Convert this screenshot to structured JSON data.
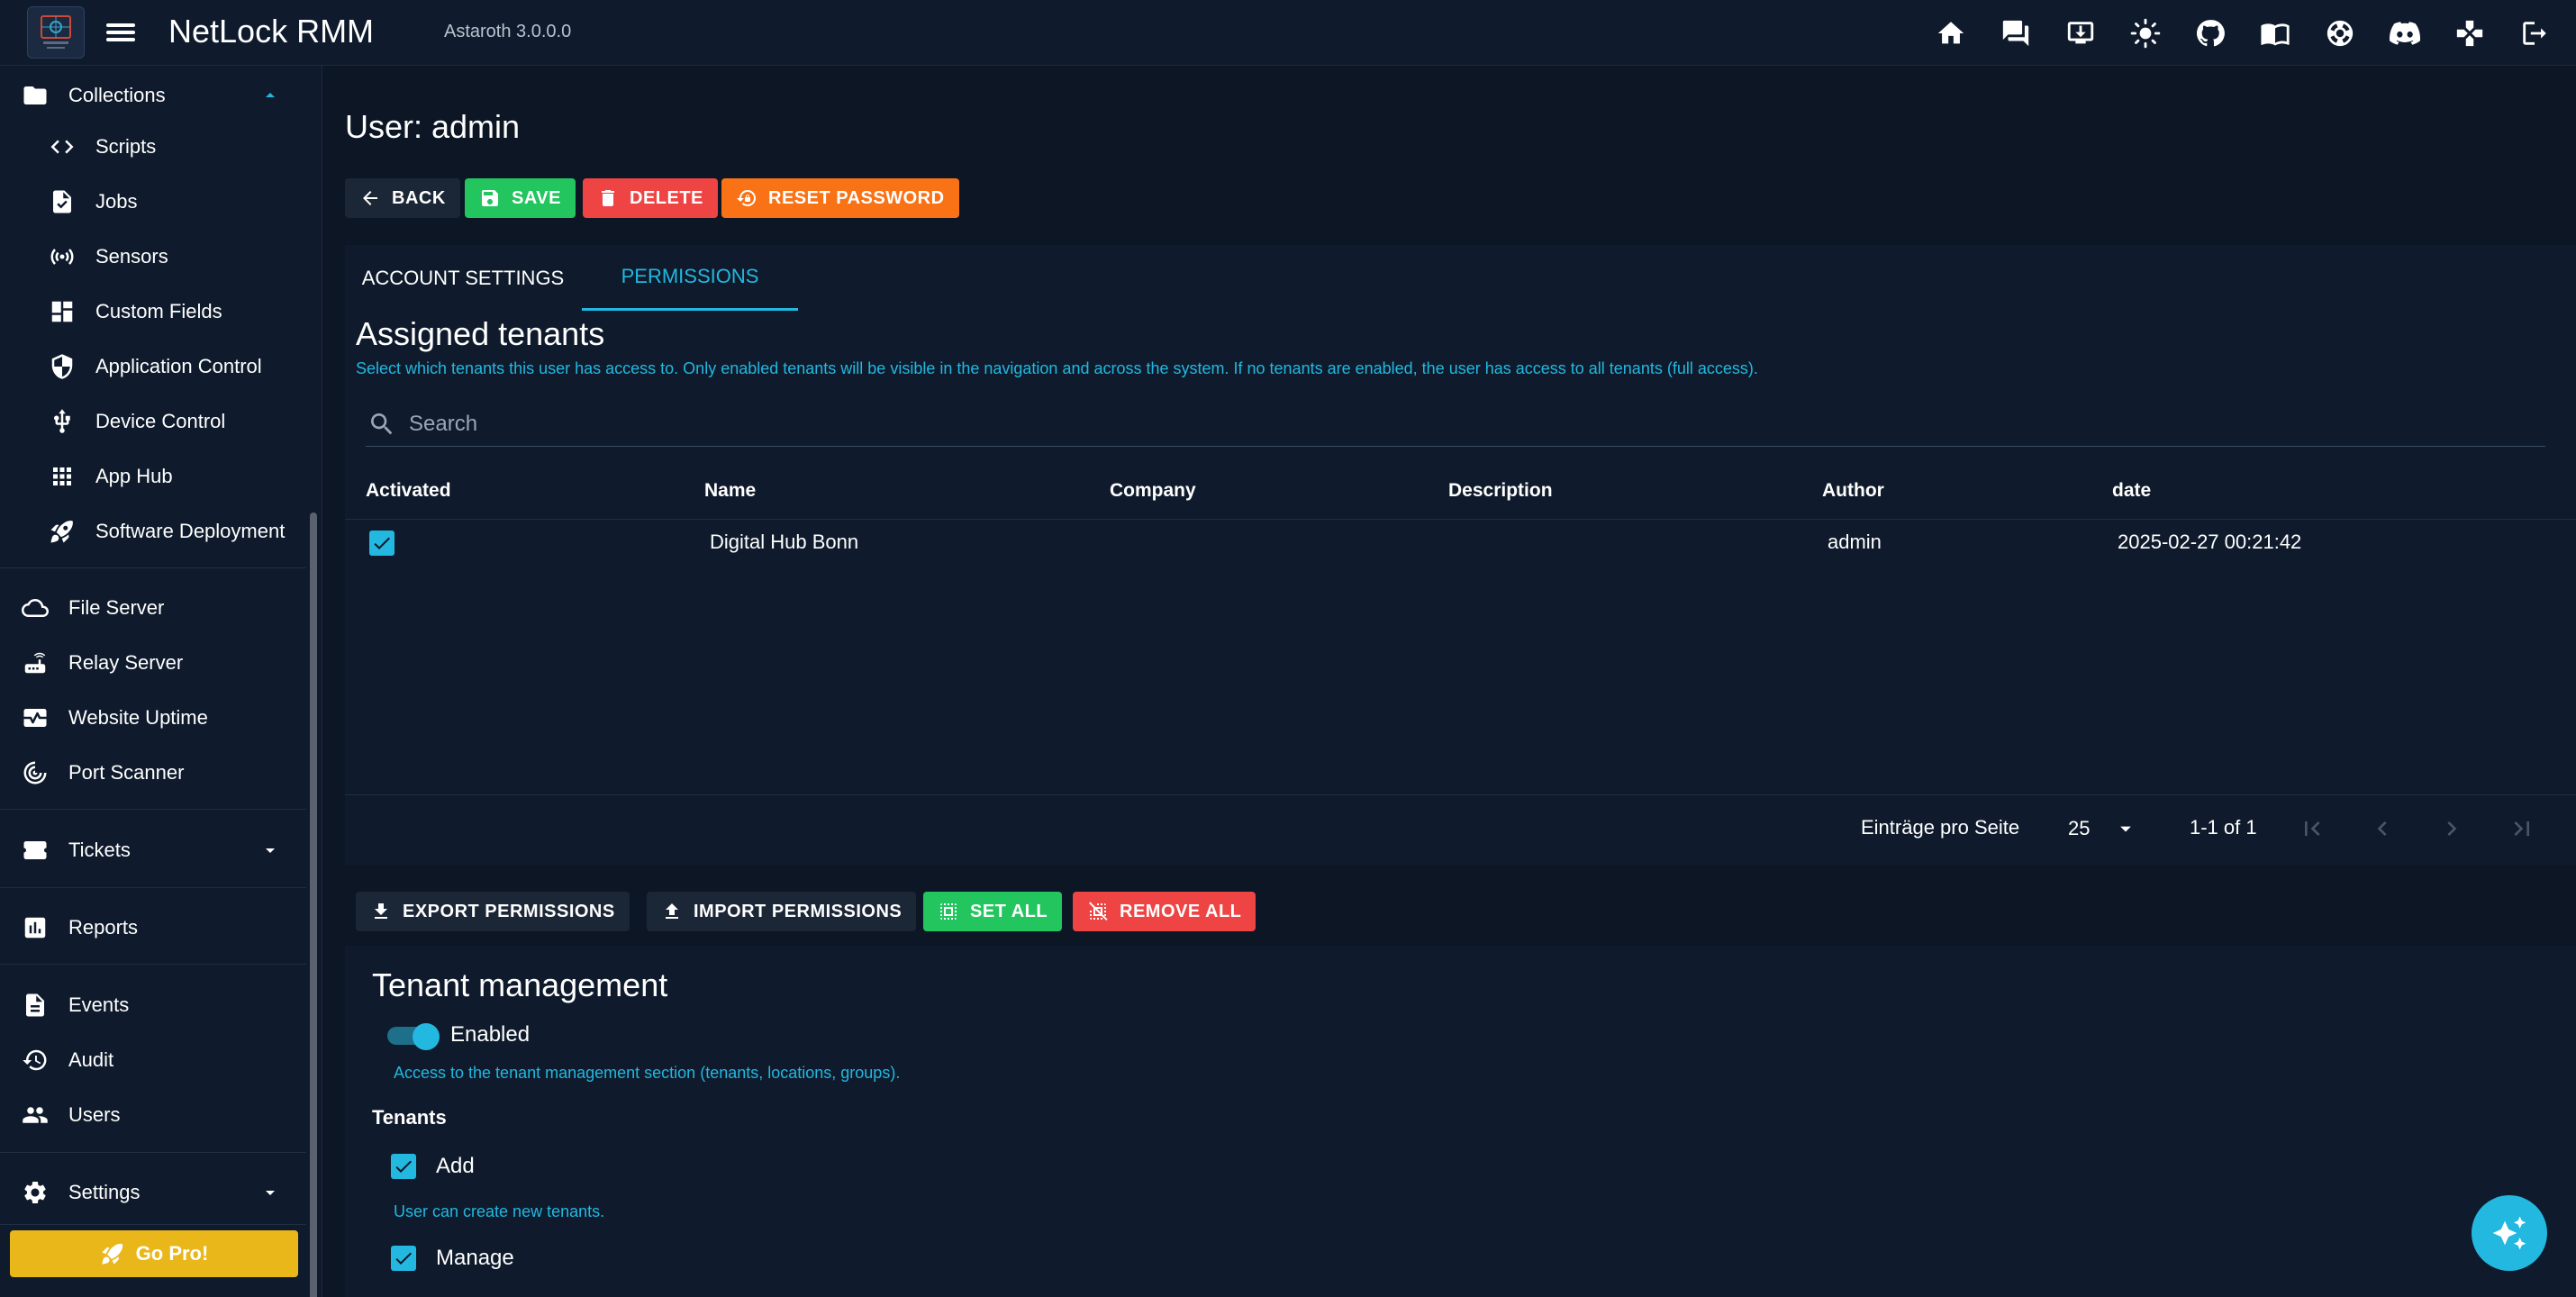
{
  "appbar": {
    "title": "NetLock RMM",
    "version": "Astaroth 3.0.0.0",
    "icons": [
      "home-icon",
      "chat-icon",
      "download-icon",
      "theme-icon",
      "github-icon",
      "docs-icon",
      "support-icon",
      "discord-icon",
      "game-icon",
      "logout-icon"
    ]
  },
  "sidebar": {
    "collections": "Collections",
    "scripts": "Scripts",
    "jobs": "Jobs",
    "sensors": "Sensors",
    "custom_fields": "Custom Fields",
    "application_control": "Application Control",
    "device_control": "Device Control",
    "app_hub": "App Hub",
    "software_deployment": "Software Deployment",
    "file_server": "File Server",
    "relay_server": "Relay Server",
    "website_uptime": "Website Uptime",
    "port_scanner": "Port Scanner",
    "tickets": "Tickets",
    "reports": "Reports",
    "events": "Events",
    "audit": "Audit",
    "users": "Users",
    "settings": "Settings",
    "go_pro": "Go Pro!"
  },
  "page": {
    "title": "User: admin",
    "back": "BACK",
    "save": "SAVE",
    "delete": "DELETE",
    "reset_password": "RESET PASSWORD"
  },
  "tabs": {
    "account_settings": "ACCOUNT SETTINGS",
    "permissions": "PERMISSIONS"
  },
  "tenants": {
    "title": "Assigned tenants",
    "hint": "Select which tenants this user has access to. Only enabled tenants will be visible in the navigation and across the system. If no tenants are enabled, the user has access to all tenants (full access).",
    "search_placeholder": "Search",
    "columns": {
      "activated": "Activated",
      "name": "Name",
      "company": "Company",
      "description": "Description",
      "author": "Author",
      "date": "date"
    },
    "rows": [
      {
        "activated": true,
        "name": "Digital Hub Bonn",
        "company": "",
        "description": "",
        "author": "admin",
        "date": "2025-02-27 00:21:42"
      }
    ],
    "pager": {
      "per_page_label": "Einträge pro Seite",
      "per_page_value": "25",
      "range": "1-1 of 1"
    }
  },
  "actions": {
    "export": "EXPORT PERMISSIONS",
    "import": "IMPORT PERMISSIONS",
    "set_all": "SET ALL",
    "remove_all": "REMOVE ALL"
  },
  "tenant_management": {
    "title": "Tenant management",
    "enabled_label": "Enabled",
    "enabled": true,
    "hint": "Access to the tenant management section (tenants, locations, groups).",
    "group_label": "Tenants",
    "add_label": "Add",
    "add_checked": true,
    "add_hint": "User can create new tenants.",
    "manage_label": "Manage",
    "manage_checked": true
  },
  "colors": {
    "background": "#0c1625",
    "surface": "#0f1b2c",
    "accent": "#22b8e0",
    "green": "#22c55e",
    "red": "#ef4444",
    "orange": "#f97316",
    "gold": "#e9b71a"
  }
}
